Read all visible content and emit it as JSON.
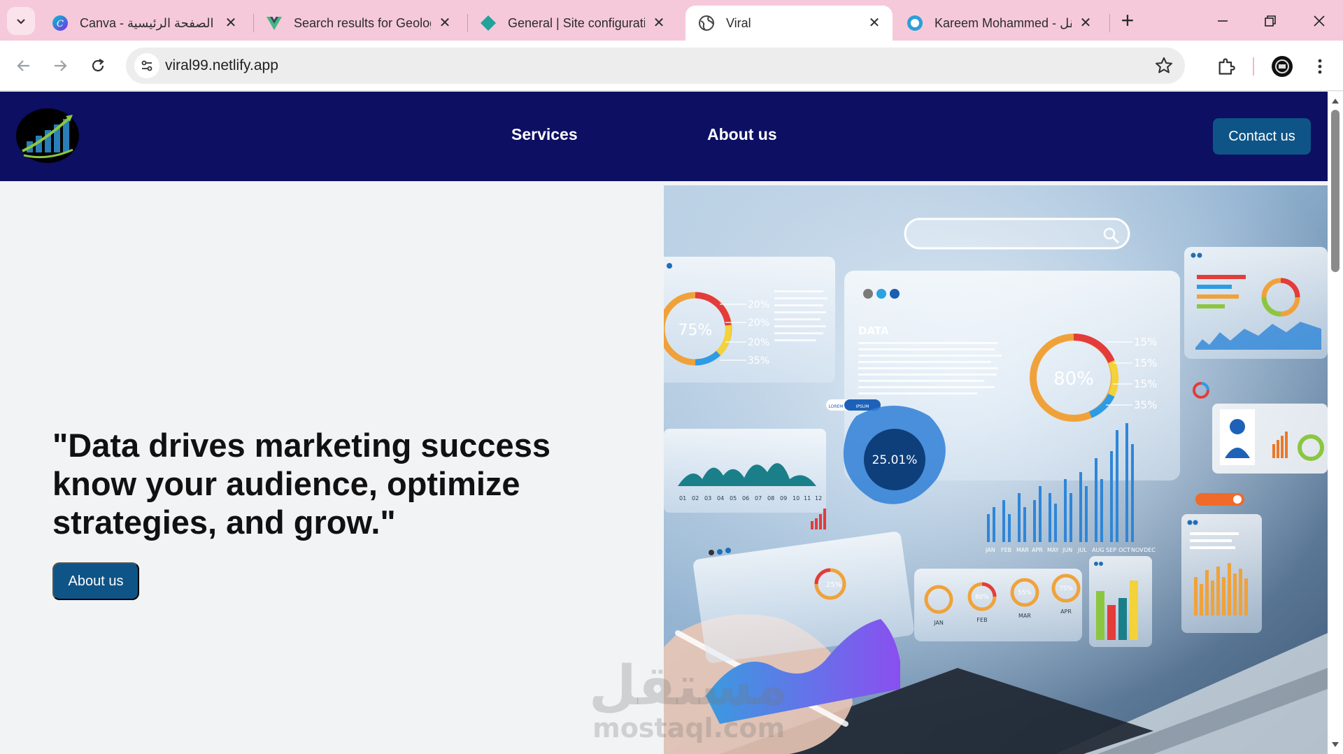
{
  "browser": {
    "tabs": [
      {
        "title": "Canva - الصفحة الرئيسية",
        "favicon": "canva-icon",
        "active": false
      },
      {
        "title": "Search results for Geolog",
        "favicon": "vue-icon",
        "active": false
      },
      {
        "title": "General | Site configurati",
        "favicon": "netlify-icon",
        "active": false
      },
      {
        "title": "Viral",
        "favicon": "globe-icon",
        "active": true
      },
      {
        "title": "Kareem Mohammed - مستقل",
        "favicon": "mostaql-icon",
        "active": false
      }
    ],
    "close_glyph": "✕",
    "new_tab_glyph": "+",
    "url": "viral99.netlify.app",
    "colors": {
      "tabbar": "#f5c9d9",
      "active_tab": "#ffffff"
    }
  },
  "site": {
    "nav": {
      "services": "Services",
      "about": "About us",
      "contact": "Contact us"
    },
    "hero": {
      "quote_line1": "\"Data drives marketing success",
      "quote_line2": "know your audience, optimize",
      "quote_line3": "strategies, and grow.\"",
      "button": "About us"
    },
    "image": {
      "panel1_pct": "75%",
      "panel1_vals": [
        "20%",
        "20%",
        "20%",
        "35%"
      ],
      "data_title": "DATA",
      "donut_pct": "80%",
      "donut_vals": [
        "15%",
        "15%",
        "15%",
        "35%"
      ],
      "blob_pct": "25.01%",
      "months": [
        "JAN",
        "FEB",
        "MAR",
        "APR",
        "MAY",
        "JUN",
        "JUL",
        "AUG",
        "SEP",
        "OCT",
        "NOV",
        "DEC"
      ],
      "area_ticks": [
        "01",
        "02",
        "03",
        "04",
        "05",
        "06",
        "07",
        "08",
        "09",
        "10",
        "11",
        "12"
      ],
      "small_gauges": [
        {
          "pct": "",
          "label": "JAN"
        },
        {
          "pct": "80%",
          "label": "FEB"
        },
        {
          "pct": "55%",
          "label": "MAR"
        },
        {
          "pct": "75%",
          "label": "APR"
        }
      ],
      "gauge_small": "25%",
      "tag_left": "LOREM",
      "tag_right": "IPSUM"
    },
    "colors": {
      "header": "#0c0f62",
      "button": "#0f5486",
      "background": "#f2f3f5"
    }
  },
  "watermark": {
    "arabic": "مستقل",
    "latin": "mostaql.com"
  }
}
